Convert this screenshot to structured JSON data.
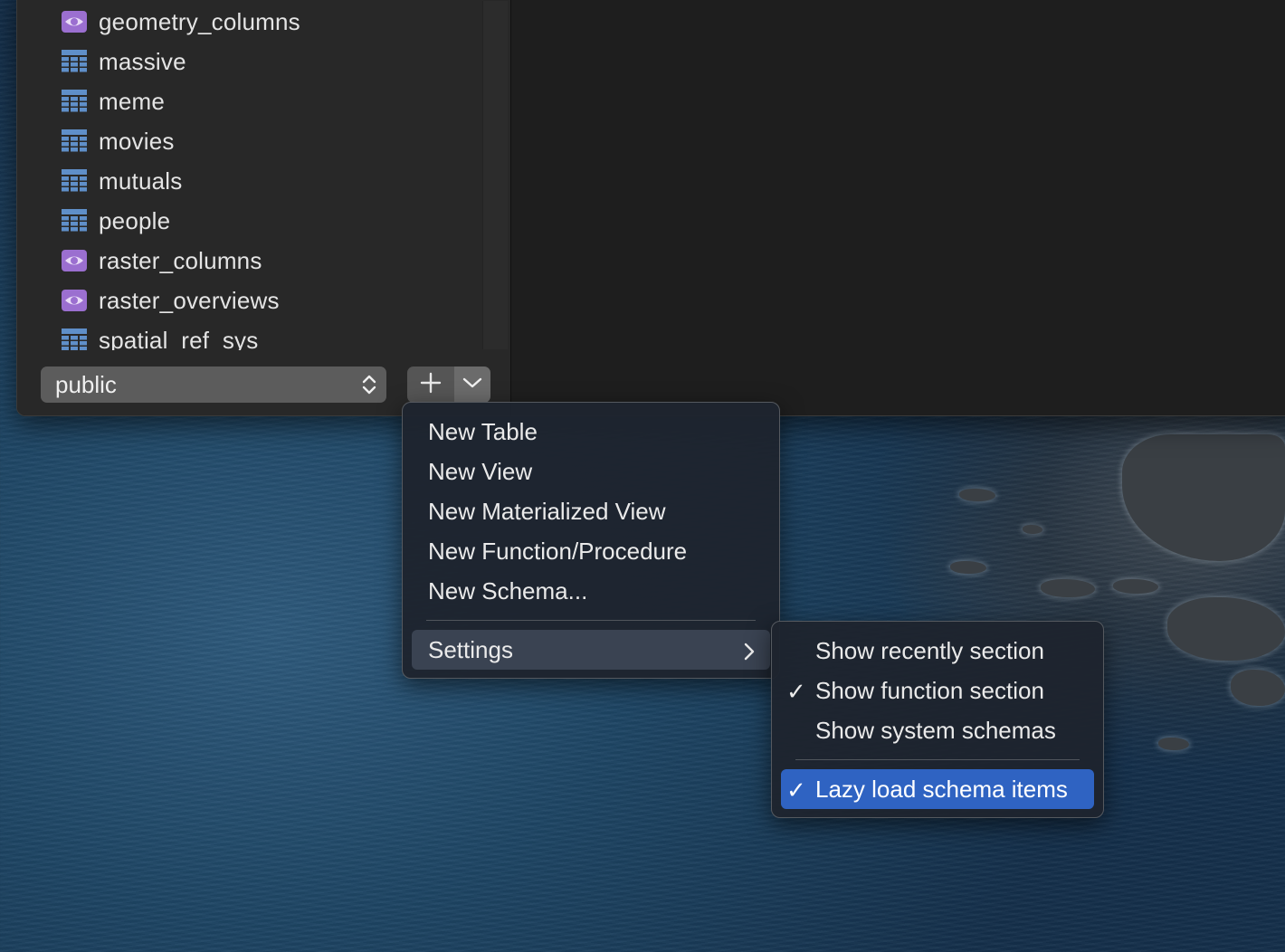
{
  "sidebar": {
    "tables": [
      {
        "label": "geometry_columns",
        "icon": "view-eye-icon"
      },
      {
        "label": "massive",
        "icon": "table-grid-icon"
      },
      {
        "label": "meme",
        "icon": "table-grid-icon"
      },
      {
        "label": "movies",
        "icon": "table-grid-icon"
      },
      {
        "label": "mutuals",
        "icon": "table-grid-icon"
      },
      {
        "label": "people",
        "icon": "table-grid-icon"
      },
      {
        "label": "raster_columns",
        "icon": "view-eye-icon"
      },
      {
        "label": "raster_overviews",
        "icon": "view-eye-icon"
      },
      {
        "label": "spatial_ref_sys",
        "icon": "table-grid-icon"
      }
    ],
    "schema_select": {
      "value": "public"
    }
  },
  "add_menu": {
    "items": [
      {
        "label": "New Table"
      },
      {
        "label": "New View"
      },
      {
        "label": "New Materialized View"
      },
      {
        "label": "New Function/Procedure"
      },
      {
        "label": "New Schema..."
      }
    ],
    "settings_label": "Settings"
  },
  "settings_menu": {
    "items": [
      {
        "label": "Show recently section",
        "checked": false
      },
      {
        "label": "Show function section",
        "checked": true
      },
      {
        "label": "Show system schemas",
        "checked": false
      }
    ],
    "lazy_load": {
      "label": "Lazy load schema items",
      "checked": true,
      "highlighted": true
    },
    "check_mark": "✓"
  },
  "colors": {
    "table_icon": "#5f8fc9",
    "view_icon": "#9b6fd0",
    "highlight": "#2f63c2"
  }
}
